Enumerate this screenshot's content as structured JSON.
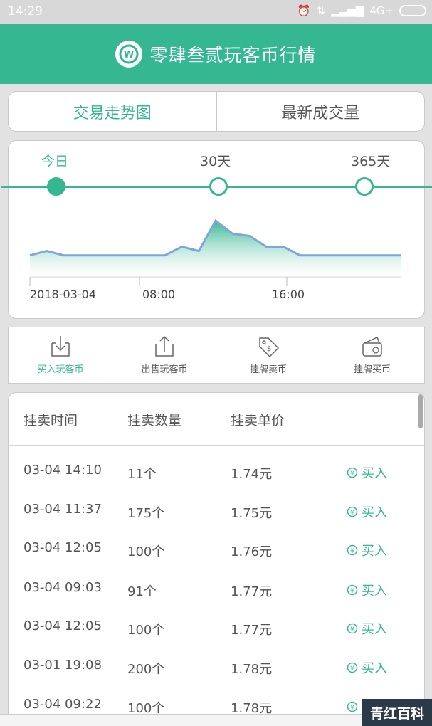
{
  "status": {
    "time": "14:29",
    "network": "4G+"
  },
  "header": {
    "title": "零肆叁贰玩客币行情",
    "logo_icon": "wanke-logo-icon"
  },
  "tabs": [
    {
      "label": "交易走势图"
    },
    {
      "label": "最新成交量"
    }
  ],
  "chart_panel": {
    "ranges": [
      {
        "label": "今日"
      },
      {
        "label": "30天"
      },
      {
        "label": "365天"
      }
    ]
  },
  "chart_data": {
    "type": "area",
    "x_labels": [
      "2018-03-04",
      "08:00",
      "16:00"
    ],
    "values": [
      0.1,
      0.12,
      0.1,
      0.1,
      0.1,
      0.1,
      0.1,
      0.1,
      0.1,
      0.14,
      0.12,
      0.26,
      0.2,
      0.19,
      0.14,
      0.14,
      0.1,
      0.1,
      0.1,
      0.1,
      0.1,
      0.1,
      0.1
    ],
    "accent_color": "#35b892",
    "line_color": "#7fa6dc"
  },
  "actions": [
    {
      "label": "买入玩客币",
      "icon": "download-tray-icon"
    },
    {
      "label": "出售玩客币",
      "icon": "upload-tray-icon"
    },
    {
      "label": "挂牌卖币",
      "icon": "price-tag-icon"
    },
    {
      "label": "挂牌买币",
      "icon": "wallet-icon"
    }
  ],
  "listing": {
    "columns": [
      "挂卖时间",
      "挂卖数量",
      "挂卖单价"
    ],
    "buy_label": "买入",
    "rows": [
      {
        "time": "03-04 14:10",
        "qty": "11个",
        "price": "1.74元"
      },
      {
        "time": "03-04 11:37",
        "qty": "175个",
        "price": "1.75元"
      },
      {
        "time": "03-04 12:05",
        "qty": "100个",
        "price": "1.76元"
      },
      {
        "time": "03-04 09:03",
        "qty": "91个",
        "price": "1.77元"
      },
      {
        "time": "03-04 12:05",
        "qty": "100个",
        "price": "1.77元"
      },
      {
        "time": "03-01 19:08",
        "qty": "200个",
        "price": "1.78元"
      },
      {
        "time": "03-04 09:22",
        "qty": "100个",
        "price": "1.78元"
      }
    ]
  },
  "watermark": "青红百科",
  "colors": {
    "accent": "#35b892",
    "statusbar": "#d8d8d8"
  }
}
